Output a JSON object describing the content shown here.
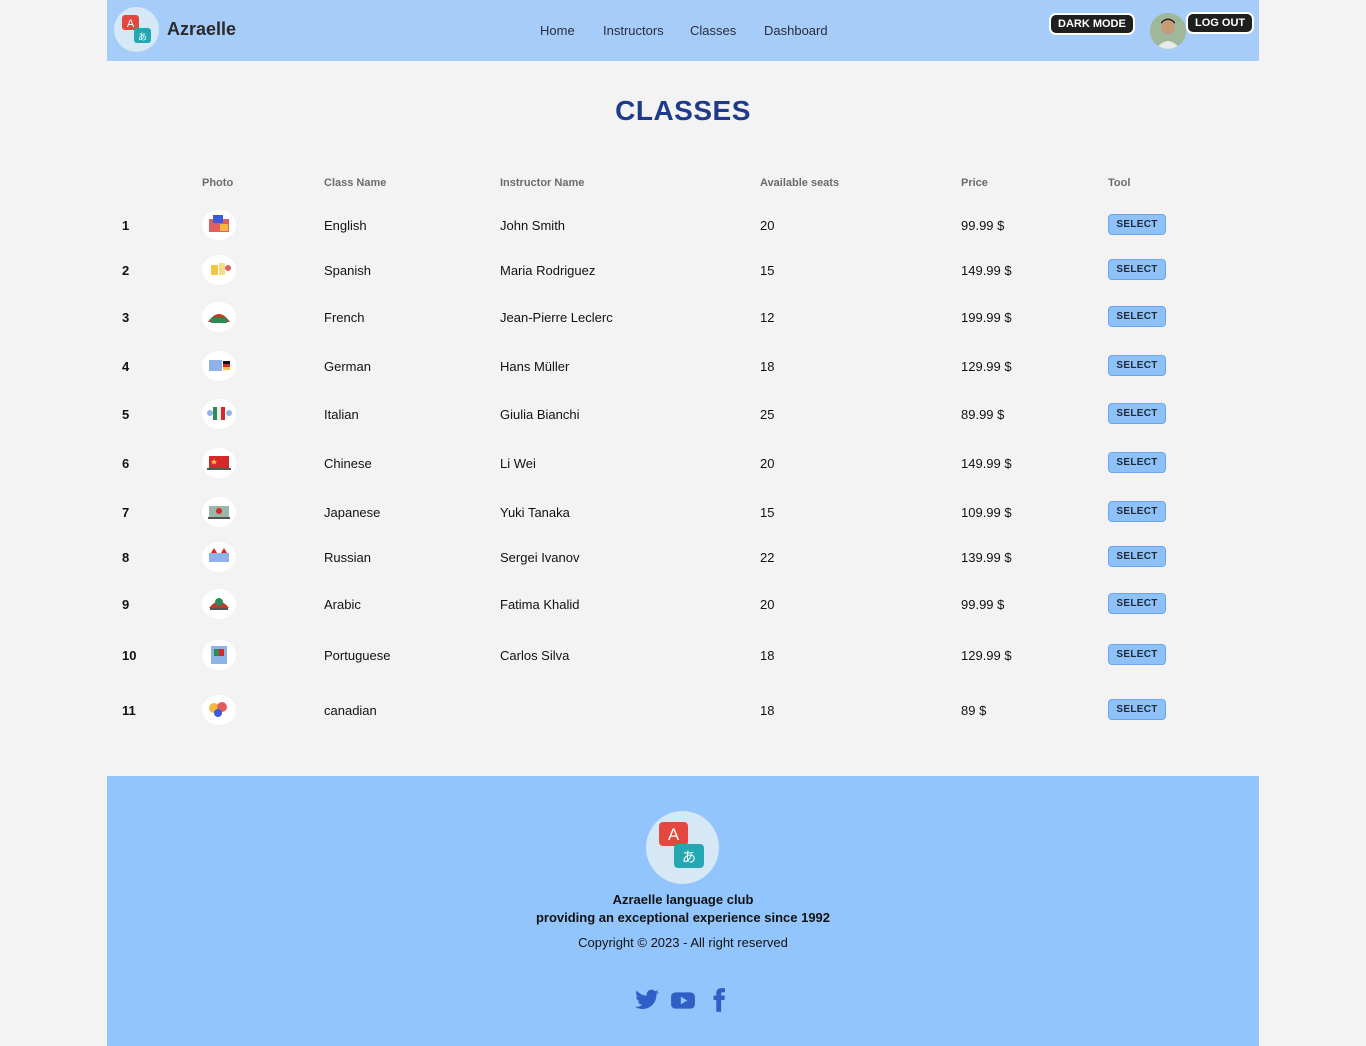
{
  "header": {
    "brand": "Azraelle",
    "nav": [
      "Home",
      "Instructors",
      "Classes",
      "Dashboard"
    ],
    "dark_mode_label": "DARK MODE",
    "logout_label": "LOG OUT"
  },
  "page": {
    "title": "CLASSES"
  },
  "table": {
    "columns": [
      "Photo",
      "Class Name",
      "Instructor Name",
      "Available seats",
      "Price",
      "Tool"
    ],
    "select_label": "SELECT",
    "rows": [
      {
        "num": "1",
        "class": "English",
        "instructor": "John Smith",
        "seats": "20",
        "price": "99.99 $"
      },
      {
        "num": "2",
        "class": "Spanish",
        "instructor": "Maria Rodriguez",
        "seats": "15",
        "price": "149.99 $"
      },
      {
        "num": "3",
        "class": "French",
        "instructor": "Jean-Pierre Leclerc",
        "seats": "12",
        "price": "199.99 $"
      },
      {
        "num": "4",
        "class": "German",
        "instructor": "Hans Müller",
        "seats": "18",
        "price": "129.99 $"
      },
      {
        "num": "5",
        "class": "Italian",
        "instructor": "Giulia Bianchi",
        "seats": "25",
        "price": "89.99 $"
      },
      {
        "num": "6",
        "class": "Chinese",
        "instructor": "Li Wei",
        "seats": "20",
        "price": "149.99 $"
      },
      {
        "num": "7",
        "class": "Japanese",
        "instructor": "Yuki Tanaka",
        "seats": "15",
        "price": "109.99 $"
      },
      {
        "num": "8",
        "class": "Russian",
        "instructor": "Sergei Ivanov",
        "seats": "22",
        "price": "139.99 $"
      },
      {
        "num": "9",
        "class": "Arabic",
        "instructor": "Fatima Khalid",
        "seats": "20",
        "price": "99.99 $"
      },
      {
        "num": "10",
        "class": "Portuguese",
        "instructor": "Carlos Silva",
        "seats": "18",
        "price": "129.99 $"
      },
      {
        "num": "11",
        "class": "canadian",
        "instructor": "",
        "seats": "18",
        "price": "89 $"
      }
    ]
  },
  "footer": {
    "club_name": "Azraelle language club",
    "tagline": "providing an exceptional experience since 1992",
    "copyright": "Copyright © 2023 - All right reserved",
    "social_icons": [
      "twitter-icon",
      "youtube-icon",
      "facebook-icon"
    ]
  },
  "colors": {
    "header_bg": "#a6cdfa",
    "footer_bg": "#93c5fd",
    "title": "#1e3a8a",
    "select_button": "#8ec1f7",
    "social_icon": "#2f5fc6"
  }
}
